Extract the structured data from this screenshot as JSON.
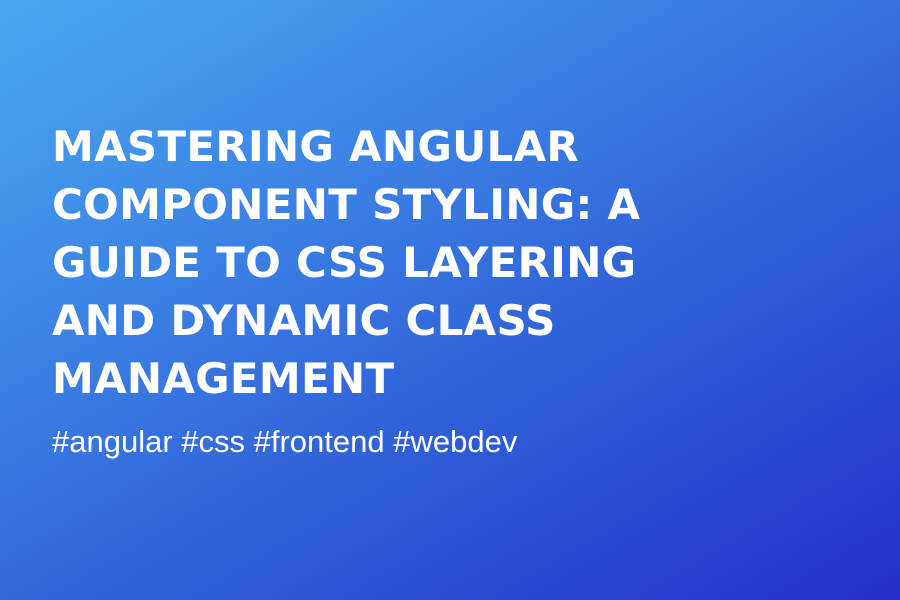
{
  "card": {
    "title_lines": [
      "MASTERING ANGULAR",
      "COMPONENT STYLING: A",
      "GUIDE TO CSS LAYERING",
      "AND DYNAMIC CLASS",
      "MANAGEMENT"
    ],
    "hashtags": "#angular #css #frontend #webdev",
    "colors": {
      "gradient_start": "#4aa9ef",
      "gradient_end": "#2430c8",
      "text": "#ffffff"
    }
  }
}
